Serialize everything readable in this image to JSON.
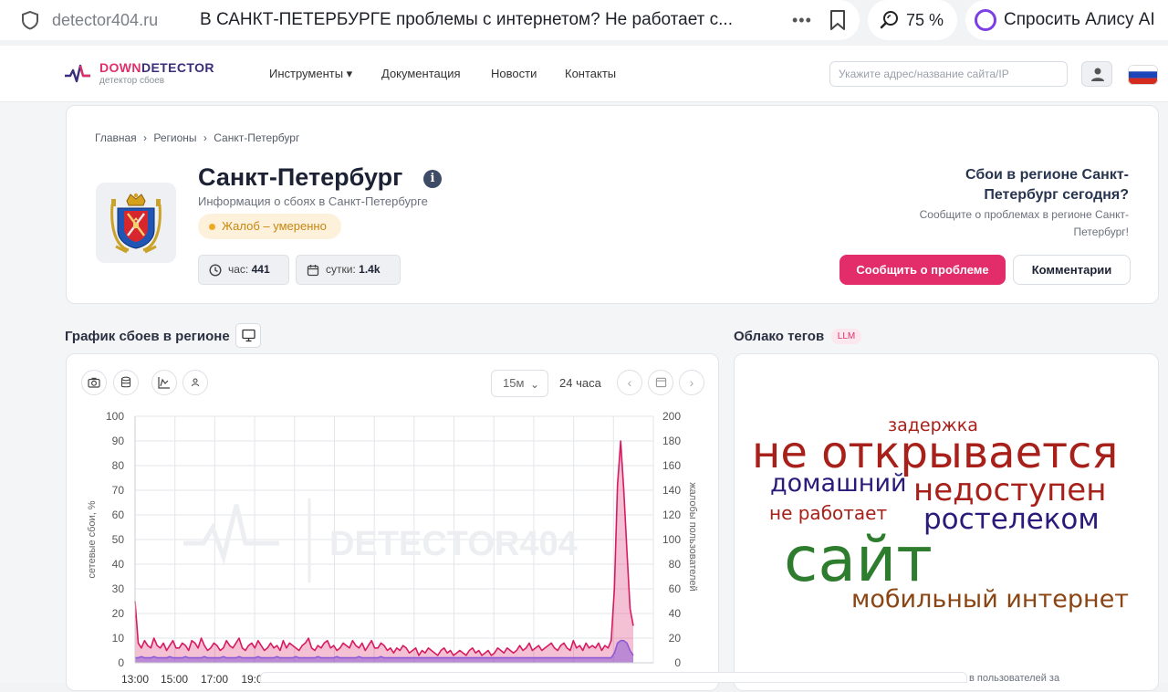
{
  "browser": {
    "domain": "detector404.ru",
    "title": "В САНКТ-ПЕТЕРБУРГЕ проблемы с интернетом? Не работает с...",
    "zoom": "75 %",
    "alice": "Спросить Алису AI"
  },
  "site": {
    "logo_down": "DOWN",
    "logo_detector": "DETECTOR",
    "logo_sub": "детектор сбоев",
    "nav": [
      "Инструменты ▾",
      "Документация",
      "Новости",
      "Контакты"
    ],
    "search_placeholder": "Укажите адрес/название сайта/IP"
  },
  "region": {
    "breadcrumb": [
      "Главная",
      "›",
      "Регионы",
      "›",
      "Санкт-Петербург"
    ],
    "title": "Санкт-Петербург",
    "subtitle": "Информация о сбоях в Санкт-Петербурге",
    "badge": "Жалоб – умеренно",
    "stat_hour_label": "час:",
    "stat_hour_value": "441",
    "stat_day_label": "сутки:",
    "stat_day_value": "1.4k",
    "cta_title": "Сбои в регионе Санкт-Петербург сегодня?",
    "cta_sub": "Сообщите о проблемах в регионе Санкт-Петербург!",
    "report_button": "Сообщить о проблеме",
    "comments_button": "Комментарии"
  },
  "chart_section": {
    "title": "График сбоев в регионе",
    "interval": "15м",
    "range": "24 часа"
  },
  "cloud_section": {
    "title": "Облако тегов",
    "badge": "LLM",
    "tags": [
      {
        "text": "задержка",
        "color": "#a8201a"
      },
      {
        "text": "не открывается",
        "color": "#a8201a"
      },
      {
        "text": "домашний",
        "color": "#2b1a7a"
      },
      {
        "text": "недоступен",
        "color": "#a8201a"
      },
      {
        "text": "не работает",
        "color": "#a8201a"
      },
      {
        "text": "ростелеком",
        "color": "#2b1a7a"
      },
      {
        "text": "сайт",
        "color": "#2e7d2e"
      },
      {
        "text": "мобильный интернет",
        "color": "#8b4513"
      }
    ]
  },
  "bottom_cut_text": "в пользователей за",
  "chart_data": {
    "type": "line",
    "watermark": "DETECTOR404",
    "ylabel": "сетевые сбои, %",
    "y2label": "жалобы пользователей",
    "ylim": [
      0,
      100
    ],
    "y2lim": [
      0,
      200
    ],
    "y_ticks": [
      0,
      10,
      20,
      30,
      40,
      50,
      60,
      70,
      80,
      90,
      100
    ],
    "y2_ticks": [
      0,
      20,
      40,
      60,
      80,
      100,
      120,
      140,
      160,
      180,
      200
    ],
    "x_tick_labels": [
      "13:00",
      "15:00",
      "17:00",
      "19:0"
    ],
    "series": [
      {
        "name": "",
        "axis": "left",
        "color": "#d81b60",
        "values": [
          25,
          8,
          6,
          9,
          7,
          6,
          10,
          7,
          6,
          8,
          5,
          7,
          9,
          6,
          6,
          8,
          7,
          5,
          9,
          8,
          6,
          10,
          7,
          5,
          6,
          8,
          7,
          5,
          6,
          9,
          7,
          6,
          8,
          10,
          6,
          5,
          7,
          8,
          6,
          9,
          7,
          5,
          6,
          8,
          6,
          7,
          5,
          9,
          6,
          8,
          7,
          6,
          5,
          7,
          8,
          10,
          6,
          5,
          7,
          6,
          8,
          9,
          6,
          7,
          5,
          6,
          8,
          7,
          6,
          9,
          7,
          6,
          8,
          5,
          7,
          9,
          6,
          6,
          8,
          7,
          5,
          6,
          4,
          6,
          5,
          7,
          6,
          4,
          5,
          6,
          3,
          5,
          4,
          6,
          5,
          4,
          3,
          5,
          6,
          4,
          5,
          3,
          4,
          5,
          4,
          3,
          5,
          6,
          4,
          5,
          3,
          4,
          5,
          3,
          4,
          6,
          5,
          4,
          6,
          5,
          4,
          5,
          7,
          5,
          6,
          8,
          5,
          6,
          7,
          5,
          6,
          7,
          8,
          6,
          5,
          7,
          8,
          6,
          5,
          9,
          6,
          7,
          5,
          8,
          6,
          7,
          6,
          8,
          5,
          7,
          6,
          9,
          30,
          72,
          90,
          70,
          45,
          22,
          15
        ]
      },
      {
        "name": "",
        "axis": "right",
        "color": "#8e5bd6",
        "values": [
          4,
          4,
          5,
          4,
          4,
          4,
          5,
          4,
          4,
          4,
          4,
          5,
          4,
          4,
          4,
          4,
          5,
          4,
          4,
          4,
          4,
          4,
          5,
          4,
          4,
          4,
          4,
          4,
          5,
          4,
          4,
          4,
          4,
          5,
          4,
          4,
          4,
          4,
          4,
          5,
          4,
          4,
          4,
          4,
          4,
          5,
          4,
          4,
          4,
          4,
          4,
          5,
          4,
          4,
          4,
          4,
          4,
          4,
          5,
          4,
          4,
          4,
          4,
          4,
          5,
          4,
          4,
          4,
          4,
          4,
          4,
          5,
          4,
          4,
          4,
          4,
          4,
          4,
          5,
          4,
          4,
          4,
          4,
          4,
          4,
          4,
          4,
          4,
          4,
          4,
          4,
          4,
          4,
          4,
          4,
          4,
          4,
          4,
          4,
          4,
          4,
          4,
          4,
          4,
          4,
          4,
          4,
          4,
          4,
          4,
          4,
          4,
          4,
          4,
          4,
          4,
          4,
          4,
          4,
          4,
          4,
          4,
          4,
          4,
          4,
          4,
          4,
          4,
          4,
          4,
          4,
          4,
          4,
          4,
          4,
          4,
          4,
          4,
          4,
          4,
          4,
          4,
          4,
          4,
          4,
          4,
          4,
          4,
          4,
          4,
          4,
          4,
          8,
          16,
          18,
          18,
          16,
          10,
          6
        ]
      }
    ]
  }
}
